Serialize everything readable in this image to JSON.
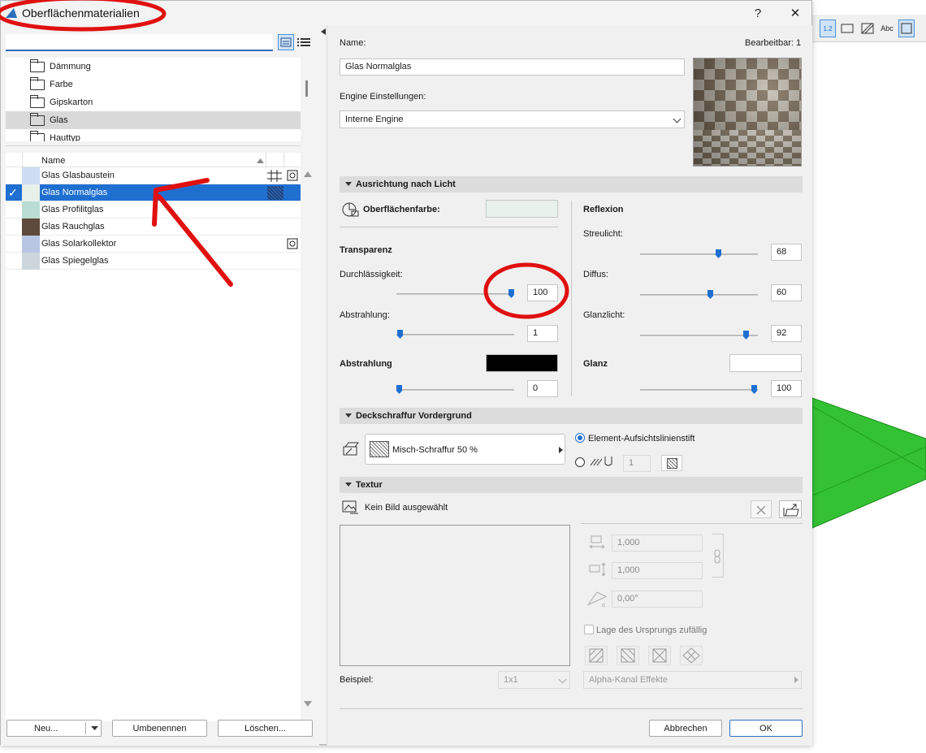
{
  "window": {
    "title": "Oberflächenmaterialien",
    "help": "?",
    "close": "✕"
  },
  "left": {
    "search": {
      "value": "",
      "placeholder": ""
    },
    "folders": [
      {
        "label": "Dämmung",
        "selected": false
      },
      {
        "label": "Farbe",
        "selected": false
      },
      {
        "label": "Gipskarton",
        "selected": false
      },
      {
        "label": "Glas",
        "selected": true
      },
      {
        "label": "Hauttyp",
        "selected": false
      }
    ],
    "table": {
      "header": "Name",
      "rows": [
        {
          "name": "Glas Glasbaustein",
          "color": "#cddcf3",
          "selected": false
        },
        {
          "name": "Glas Normalglas",
          "color": "#e8f0ea",
          "selected": true
        },
        {
          "name": "Glas Profilitglas",
          "color": "#b9ddd2",
          "selected": false
        },
        {
          "name": "Glas Rauchglas",
          "color": "#5e4a3c",
          "selected": false
        },
        {
          "name": "Glas Solarkollektor",
          "color": "#b8c6e2",
          "selected": false
        },
        {
          "name": "Glas Spiegelglas",
          "color": "#cdd6dc",
          "selected": false
        }
      ]
    },
    "buttons": {
      "new": "Neu...",
      "rename": "Umbenennen",
      "delete": "Löschen..."
    }
  },
  "right": {
    "name_label": "Name:",
    "editable": "Bearbeitbar: 1",
    "name_value": "Glas Normalglas",
    "engine_label": "Engine Einstellungen:",
    "engine_value": "Interne Engine",
    "sec_light": "Ausrichtung nach Licht",
    "surface_color": "Oberflächenfarbe:",
    "surface_swatch": "#e9f1ec",
    "transparency": "Transparenz",
    "durch_label": "Durchlässigkeit:",
    "durch_value": "100",
    "durch_level": 1.0,
    "abstr_label": "Abstrahlung:",
    "abstr_value": "1",
    "abstr_level": 0.0,
    "abstr2_label": "Abstrahlung",
    "abstr2_swatch": "#000000",
    "abstr2_value": "0",
    "abstr2_level": 0.0,
    "reflexion": "Reflexion",
    "streu_label": "Streulicht:",
    "streu_value": "68",
    "streu_level": 0.68,
    "diffus_label": "Diffus:",
    "diffus_value": "60",
    "diffus_level": 0.6,
    "glanzl_label": "Glanzlicht:",
    "glanzl_value": "92",
    "glanzl_level": 0.92,
    "glanz_label": "Glanz",
    "glanz_swatch": "#ffffff",
    "glanz_value": "100",
    "glanz_level": 1.0,
    "sec_hatch": "Deckschraffur Vordergrund",
    "hatch_value": "Misch-Schraffur 50 %",
    "radio1": "Element-Aufsichtslinienstift",
    "pen_value": "1",
    "sec_tex": "Textur",
    "tex_none": "Kein Bild ausgewählt",
    "tex_w": "1,000",
    "tex_h": "1,000",
    "tex_angle": "0,00°",
    "random_origin": "Lage des Ursprungs zufällig",
    "example_label": "Beispiel:",
    "example_value": "1x1",
    "alpha": "Alpha-Kanal Effekte",
    "cancel": "Abbrechen",
    "ok": "OK"
  },
  "background": {
    "toolbar_label": "1.2",
    "abc": "Abc"
  }
}
